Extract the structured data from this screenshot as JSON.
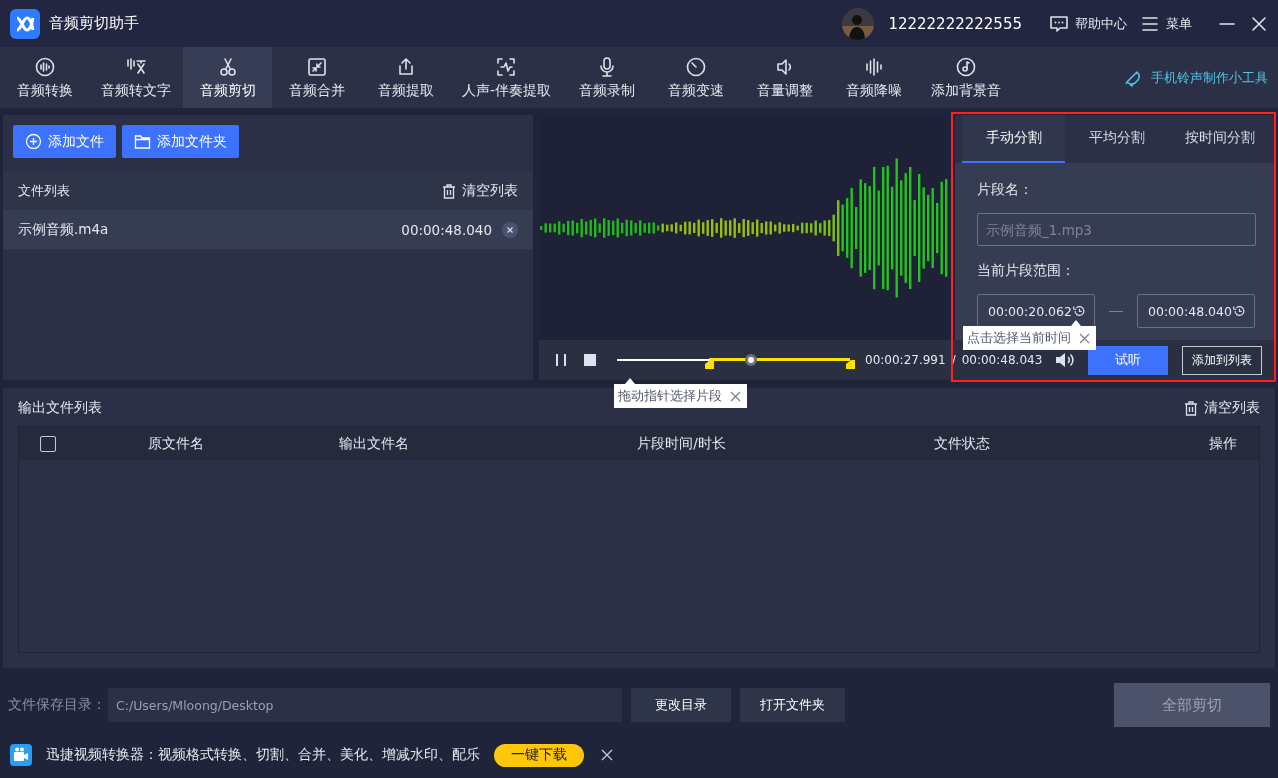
{
  "window": {
    "title": "音频剪切助手",
    "user": "12222222222555",
    "help": "帮助中心",
    "menu": "菜单"
  },
  "toolbar": {
    "items": [
      {
        "label": "音频转换",
        "selected": false
      },
      {
        "label": "音频转文字",
        "selected": false
      },
      {
        "label": "音频剪切",
        "selected": true
      },
      {
        "label": "音频合并",
        "selected": false
      },
      {
        "label": "音频提取",
        "selected": false
      },
      {
        "label": "人声-伴奏提取",
        "selected": false
      },
      {
        "label": "音频录制",
        "selected": false
      },
      {
        "label": "音频变速",
        "selected": false
      },
      {
        "label": "音量调整",
        "selected": false
      },
      {
        "label": "音频降噪",
        "selected": false
      },
      {
        "label": "添加背景音",
        "selected": false
      }
    ],
    "ringtone_link": "手机铃声制作小工具"
  },
  "file_panel": {
    "buttons": [
      "添加文件",
      "添加文件夹"
    ],
    "list_title": "文件列表",
    "clear_label": "清空列表",
    "files": [
      {
        "name": "示例音频.m4a",
        "duration": "00:00:48.040",
        "selected": true
      }
    ]
  },
  "split_panel": {
    "tabs": [
      {
        "label": "手动分割",
        "selected": true
      },
      {
        "label": "平均分割",
        "selected": false
      },
      {
        "label": "按时间分割",
        "selected": false
      }
    ],
    "name_label": "片段名：",
    "name_placeholder": "示例音频_1.mp3",
    "range_label": "当前片段范围：",
    "start_time": "00:00:20.062",
    "end_time": "00:00:48.040",
    "tooltip": "点击选择当前时间"
  },
  "player": {
    "playing": true,
    "playhead": {
      "level": 0.575
    },
    "range_start": {
      "level": 0.395
    },
    "range_end": {
      "level": 1
    },
    "current_time": "00:00:27.991",
    "separator": "/",
    "total_time": "00:00:48.043",
    "preview_button": "试听",
    "add_button": "添加到列表",
    "hint": "拖动指针选择片段"
  },
  "output": {
    "title": "输出文件列表",
    "clear_label": "清空列表",
    "select_all": {
      "checked": false
    },
    "columns": [
      "原文件名",
      "输出文件名",
      "片段时间/时长",
      "文件状态",
      "操作"
    ]
  },
  "footer": {
    "save_label": "文件保存目录：",
    "save_path": "C:/Users/Mloong/Desktop",
    "buttons": [
      "更改目录",
      "打开文件夹"
    ],
    "cut_all": {
      "label": "全部剪切",
      "disabled": true
    }
  },
  "ad": {
    "text": "迅捷视频转换器：视频格式转换、切割、合并、美化、增减水印、配乐",
    "button": "一键下载"
  }
}
